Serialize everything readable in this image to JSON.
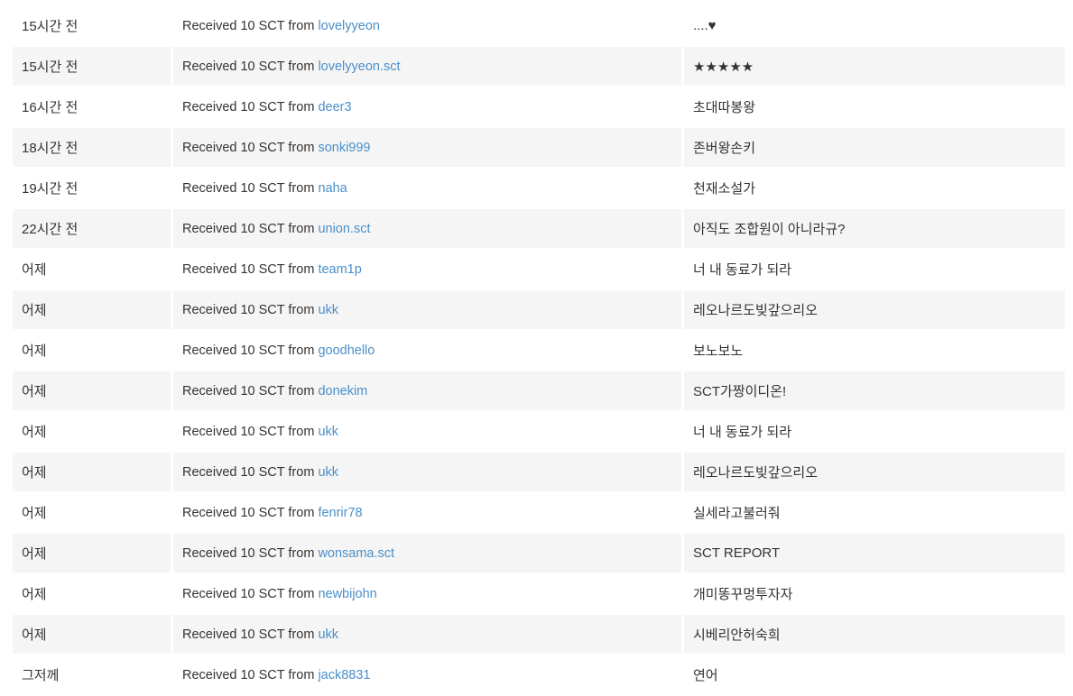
{
  "transfer_prefix": "Received 10 SCT from ",
  "colors": {
    "link": "#4a8fc9",
    "text": "#333333",
    "row_shade": "#f5f5f5"
  },
  "rows": [
    {
      "time": "15시간 전",
      "sender": "lovelyyeon",
      "memo": "....♥"
    },
    {
      "time": "15시간 전",
      "sender": "lovelyyeon.sct",
      "memo": "★★★★★"
    },
    {
      "time": "16시간 전",
      "sender": "deer3",
      "memo": "초대따봉왕"
    },
    {
      "time": "18시간 전",
      "sender": "sonki999",
      "memo": "존버왕손키"
    },
    {
      "time": "19시간 전",
      "sender": "naha",
      "memo": "천재소설가"
    },
    {
      "time": "22시간 전",
      "sender": "union.sct",
      "memo": "아직도 조합원이 아니라규?"
    },
    {
      "time": "어제",
      "sender": "team1p",
      "memo": "너 내 동료가 되라"
    },
    {
      "time": "어제",
      "sender": "ukk",
      "memo": "레오나르도빚갚으리오"
    },
    {
      "time": "어제",
      "sender": "goodhello",
      "memo": "보노보노"
    },
    {
      "time": "어제",
      "sender": "donekim",
      "memo": "SCT가짱이디온!"
    },
    {
      "time": "어제",
      "sender": "ukk",
      "memo": "너 내 동료가 되라"
    },
    {
      "time": "어제",
      "sender": "ukk",
      "memo": "레오나르도빚갚으리오"
    },
    {
      "time": "어제",
      "sender": "fenrir78",
      "memo": "실세라고불러줘"
    },
    {
      "time": "어제",
      "sender": "wonsama.sct",
      "memo": "SCT REPORT"
    },
    {
      "time": "어제",
      "sender": "newbijohn",
      "memo": "개미똥꾸멍투자자"
    },
    {
      "time": "어제",
      "sender": "ukk",
      "memo": "시베리안허숙희"
    },
    {
      "time": "그저께",
      "sender": "jack8831",
      "memo": "연어"
    }
  ]
}
